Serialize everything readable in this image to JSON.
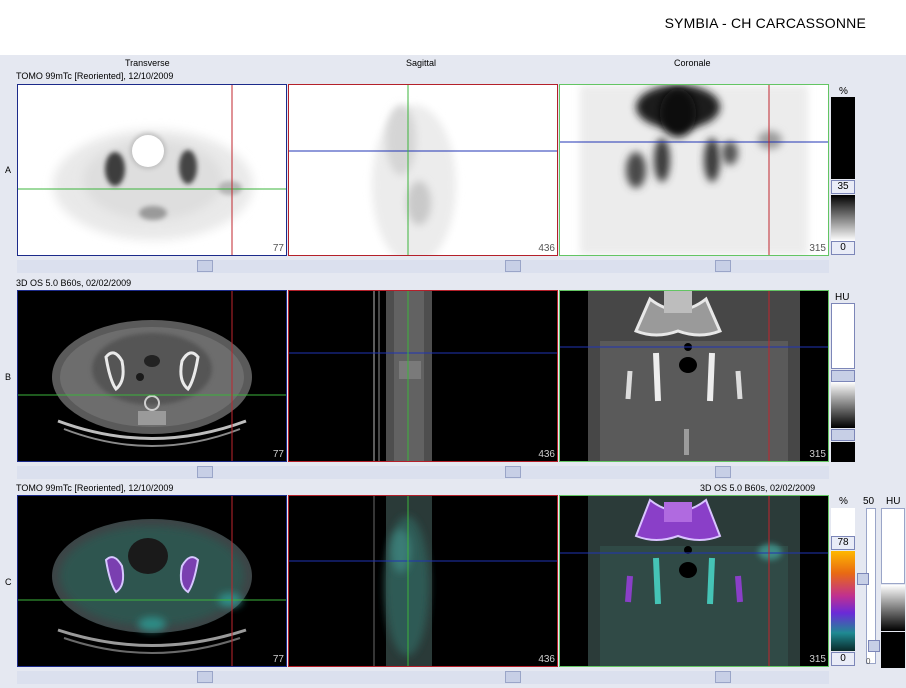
{
  "header": {
    "title": "SYMBIA - CH CARCASSONNE"
  },
  "columns": {
    "transverse": "Transverse",
    "sagittal": "Sagittal",
    "coronal": "Coronale"
  },
  "rows": [
    {
      "label": "A",
      "series": "TOMO 99mTc [Reoriented], 12/10/2009",
      "slices": [
        "77",
        "436",
        "315"
      ]
    },
    {
      "label": "B",
      "series": "3D  OS  5.0  B60s, 02/02/2009",
      "slices": [
        "77",
        "436",
        "315"
      ]
    },
    {
      "label": "C",
      "series": "TOMO 99mTc [Reoriented], 12/10/2009",
      "series_right": "3D  OS  5.0  B60s, 02/02/2009",
      "slices": [
        "77",
        "436",
        "315"
      ]
    }
  ],
  "scales": {
    "spect": {
      "unit": "%",
      "upper": "35",
      "lower": "0"
    },
    "ct": {
      "unit": "HU"
    },
    "fusion": {
      "unit_pct": "%",
      "upper": "78",
      "lower": "0",
      "blend": "50",
      "unit_hu": "HU",
      "blend_min": "0"
    }
  },
  "colors": {
    "axis_vertical": "#c0262e",
    "axis_horizontal_green": "#3cb43c",
    "axis_horizontal_blue": "#2034b4",
    "frame_transverse": "#1c2a8a",
    "frame_sagittal": "#b4202a",
    "frame_coronal": "#63c563",
    "fusion_cyan": "#45c4b6",
    "fusion_purple": "#a24de2"
  }
}
